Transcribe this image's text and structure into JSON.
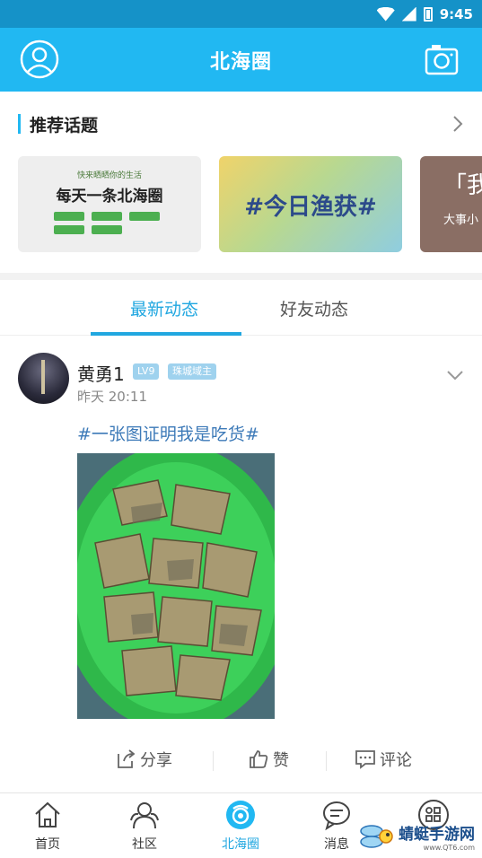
{
  "status_bar": {
    "time": "9:45"
  },
  "app_bar": {
    "title": "北海圈"
  },
  "topics": {
    "section_title": "推荐话题",
    "cards": [
      {
        "top_text": "快来晒晒你的生活",
        "main_text": "每天一条北海圈"
      },
      {
        "main_text": "#今日渔获#"
      },
      {
        "main_text": "「我",
        "sub_text": "大事小"
      }
    ]
  },
  "feed_tabs": [
    {
      "label": "最新动态",
      "active": true
    },
    {
      "label": "好友动态",
      "active": false
    }
  ],
  "post": {
    "username": "黄勇1",
    "level": "LV9",
    "title_badge": "珠城域主",
    "time": "昨天 20:11",
    "hashtag": "#一张图证明我是吃货#",
    "actions": {
      "share": "分享",
      "like": "赞",
      "comment": "评论"
    }
  },
  "bottom_nav": [
    {
      "label": "首页",
      "icon": "home-icon"
    },
    {
      "label": "社区",
      "icon": "community-icon"
    },
    {
      "label": "北海圈",
      "icon": "beihai-circle-icon",
      "active": true
    },
    {
      "label": "消息",
      "icon": "message-icon"
    },
    {
      "label": "",
      "icon": "grid-apps-icon"
    }
  ],
  "watermark": {
    "text": "蜻蜓手游网",
    "url": "www.QT6.com"
  },
  "colors": {
    "primary": "#21b8f2",
    "status_bar": "#1592c8",
    "tab_active": "#21a7e0",
    "hashtag": "#3d7ab8"
  }
}
